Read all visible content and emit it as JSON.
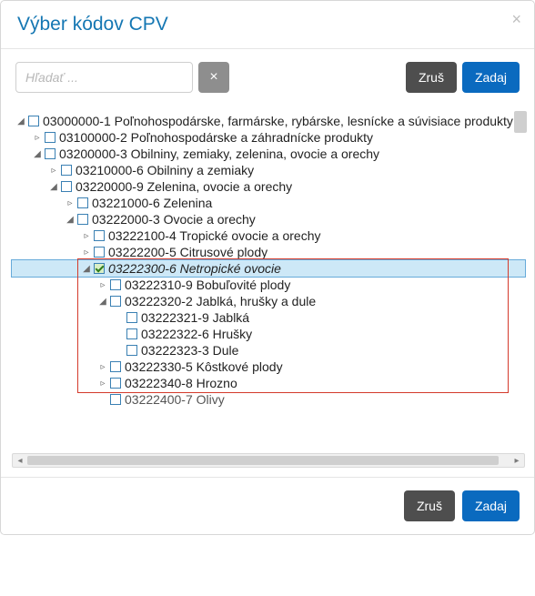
{
  "header": {
    "title": "Výber kódov CPV"
  },
  "search": {
    "placeholder": "Hľadať ...",
    "clear_symbol": "×"
  },
  "buttons": {
    "cancel": "Zruš",
    "submit": "Zadaj"
  },
  "glyphs": {
    "open": "◢",
    "closed": "▹"
  },
  "tree": [
    {
      "depth": 0,
      "exp": "open",
      "chk": false,
      "sel": false,
      "label": "03000000-1 Poľnohospodárske, farmárske, rybárske, lesnícke a súvisiace produkty"
    },
    {
      "depth": 1,
      "exp": "closed",
      "chk": false,
      "sel": false,
      "label": "03100000-2 Poľnohospodárske a záhradnícke produkty"
    },
    {
      "depth": 1,
      "exp": "open",
      "chk": false,
      "sel": false,
      "label": "03200000-3 Obilniny, zemiaky, zelenina, ovocie a orechy"
    },
    {
      "depth": 2,
      "exp": "closed",
      "chk": false,
      "sel": false,
      "label": "03210000-6 Obilniny a zemiaky"
    },
    {
      "depth": 2,
      "exp": "open",
      "chk": false,
      "sel": false,
      "label": "03220000-9 Zelenina, ovocie a orechy"
    },
    {
      "depth": 3,
      "exp": "closed",
      "chk": false,
      "sel": false,
      "label": "03221000-6 Zelenina"
    },
    {
      "depth": 3,
      "exp": "open",
      "chk": false,
      "sel": false,
      "label": "03222000-3 Ovocie a orechy"
    },
    {
      "depth": 4,
      "exp": "closed",
      "chk": false,
      "sel": false,
      "label": "03222100-4 Tropické ovocie a orechy"
    },
    {
      "depth": 4,
      "exp": "closed",
      "chk": false,
      "sel": false,
      "label": "03222200-5 Citrusové plody"
    },
    {
      "depth": 4,
      "exp": "open",
      "chk": true,
      "sel": true,
      "label": "03222300-6 Netropické ovocie"
    },
    {
      "depth": 5,
      "exp": "closed",
      "chk": false,
      "sel": false,
      "label": "03222310-9 Bobuľovité plody"
    },
    {
      "depth": 5,
      "exp": "open",
      "chk": false,
      "sel": false,
      "label": "03222320-2 Jablká, hrušky a dule"
    },
    {
      "depth": 6,
      "exp": "none",
      "chk": false,
      "sel": false,
      "label": "03222321-9 Jablká"
    },
    {
      "depth": 6,
      "exp": "none",
      "chk": false,
      "sel": false,
      "label": "03222322-6 Hrušky"
    },
    {
      "depth": 6,
      "exp": "none",
      "chk": false,
      "sel": false,
      "label": "03222323-3 Dule"
    },
    {
      "depth": 5,
      "exp": "closed",
      "chk": false,
      "sel": false,
      "label": "03222330-5 Kôstkové plody"
    },
    {
      "depth": 5,
      "exp": "closed",
      "chk": false,
      "sel": false,
      "label": "03222340-8 Hrozno"
    },
    {
      "depth": 5,
      "exp": "none",
      "chk": false,
      "sel": false,
      "label": "03222400-7 Olivy",
      "cut": true
    }
  ]
}
